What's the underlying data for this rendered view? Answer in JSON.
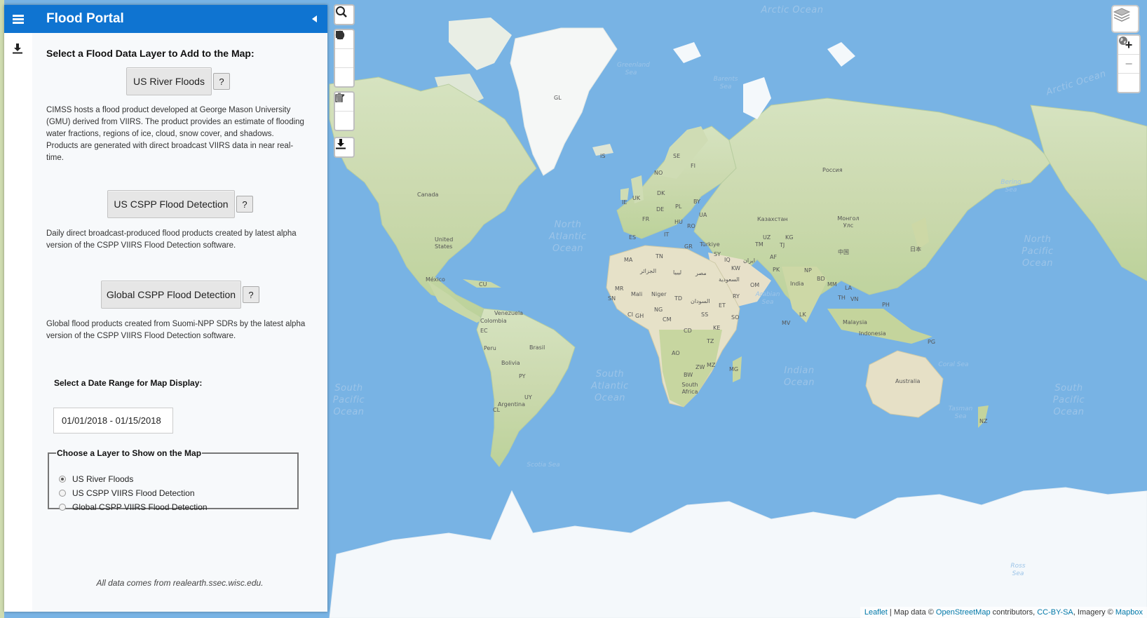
{
  "header": {
    "title": "Flood Portal"
  },
  "sidebar": {
    "section_title": "Select a Flood Data Layer to Add to the Map:",
    "layers": [
      {
        "label": "US River Floods",
        "help": "?",
        "description": "CIMSS hosts a flood product developed at George Mason University (GMU) derived from VIIRS. The product provides an estimate of flooding water fractions, regions of ice, cloud, snow cover, and shadows. Products are generated with direct broadcast VIIRS data in near real-time."
      },
      {
        "label": "US CSPP Flood Detection",
        "help": "?",
        "description": "Daily direct broadcast-produced flood products created by latest alpha version of the CSPP VIIRS Flood Detection software."
      },
      {
        "label": "Global CSPP Flood Detection",
        "help": "?",
        "description": "Global flood products created from Suomi-NPP SDRs by the latest alpha version of the CSPP VIIRS Flood Detection software."
      }
    ],
    "date_label": "Select a Date Range for Map Display:",
    "date_value": "01/01/2018 - 01/15/2018",
    "show_layer": {
      "legend": "Choose a Layer to Show on the Map",
      "options": [
        "US River Floods",
        "US CSPP VIIRS Flood Detection",
        "Global CSPP VIIRS Flood Detection"
      ],
      "selected_index": 0
    },
    "footer": "All data comes from realearth.ssec.wisc.edu."
  },
  "map": {
    "zoom_in": "+",
    "zoom_out": "−",
    "oceans": {
      "arctic_top": "Arctic Ocean",
      "arctic_right": "Arctic Ocean",
      "north_atlantic": "North Atlantic Ocean",
      "south_atlantic": "South Atlantic Ocean",
      "north_pacific": "North Pacific Ocean",
      "south_pacific_left": "South Pacific Ocean",
      "south_pacific_right": "South Pacific Ocean",
      "indian": "Indian Ocean"
    },
    "seas": {
      "greenland": "Greenland Sea",
      "barents": "Barents Sea",
      "arabian": "Arabian Sea",
      "coral": "Coral Sea",
      "tasman": "Tasman Sea",
      "scotia": "Scotia Sea",
      "ross": "Ross Sea",
      "bering": "Bering Sea"
    },
    "countries": {
      "gl": "GL",
      "canada": "Canada",
      "us": "United States",
      "mexico": "México",
      "cu": "CU",
      "venezuela": "Venezuela",
      "colombia": "Colombia",
      "ec": "EC",
      "peru": "Peru",
      "brasil": "Brasil",
      "bolivia": "Bolivia",
      "py": "PY",
      "uy": "UY",
      "cl": "CL",
      "argentina": "Argentina",
      "is": "IS",
      "no": "NO",
      "se": "SE",
      "fi": "FI",
      "dk": "DK",
      "uk": "UK",
      "ie": "IE",
      "fr": "FR",
      "de": "DE",
      "pl": "PL",
      "by": "BY",
      "ua": "UA",
      "es": "ES",
      "it": "IT",
      "gr": "GR",
      "hu": "HU",
      "ro": "RO",
      "ma": "MA",
      "tn": "TN",
      "turkiye": "Türkiye",
      "sy": "SY",
      "iq": "IQ",
      "iran": "ایران",
      "kw": "KW",
      "sa": "السعودية",
      "om": "OM",
      "ye": "RY",
      "af": "AF",
      "pk": "PK",
      "india": "India",
      "np": "NP",
      "bd": "BD",
      "russia": "Россия",
      "kz": "Казахстан",
      "uz": "UZ",
      "tm": "TM",
      "kg": "KG",
      "tj": "TJ",
      "mongolia": "Монгол Улс",
      "china": "中国",
      "japan": "日本",
      "mm": "MM",
      "th": "TH",
      "la": "LA",
      "vn": "VN",
      "ph": "PH",
      "malaysia": "Malaysia",
      "indonesia": "Indonesia",
      "pg": "PG",
      "australia": "Australia",
      "nz": "NZ",
      "lk": "LK",
      "mv": "MV",
      "libya": "ليبيا",
      "egypt": "مصر",
      "algeria": "الجزائر",
      "mali": "Mali",
      "niger": "Niger",
      "mr": "MR",
      "sn": "SN",
      "td": "TD",
      "sudan": "السودان",
      "et": "ET",
      "ss": "SS",
      "ng": "NG",
      "cm": "CM",
      "ci": "CI",
      "gh": "GH",
      "cd": "CD",
      "ke": "KE",
      "so": "SO",
      "tz": "TZ",
      "ao": "AO",
      "zw": "ZW",
      "mz": "MZ",
      "bw": "BW",
      "mg": "MG",
      "south_africa": "South Africa"
    },
    "attribution": {
      "leaflet": "Leaflet",
      "sep1": " | Map data © ",
      "osm": "OpenStreetMap",
      "contrib": " contributors, ",
      "license": "CC-BY-SA",
      "imagery": ", Imagery © ",
      "mapbox": "Mapbox"
    }
  },
  "colors": {
    "header": "#0f74d1",
    "ocean": "#78b3e4",
    "land": "#cfdcb0",
    "ice": "#f4f8fb"
  },
  "icons": [
    "menu-icon",
    "collapse-left-icon",
    "download-icon",
    "search-icon",
    "polygon-icon",
    "rectangle-icon",
    "circle-icon",
    "edit-icon",
    "trash-icon",
    "download-icon",
    "layers-icon",
    "globe-icon"
  ]
}
